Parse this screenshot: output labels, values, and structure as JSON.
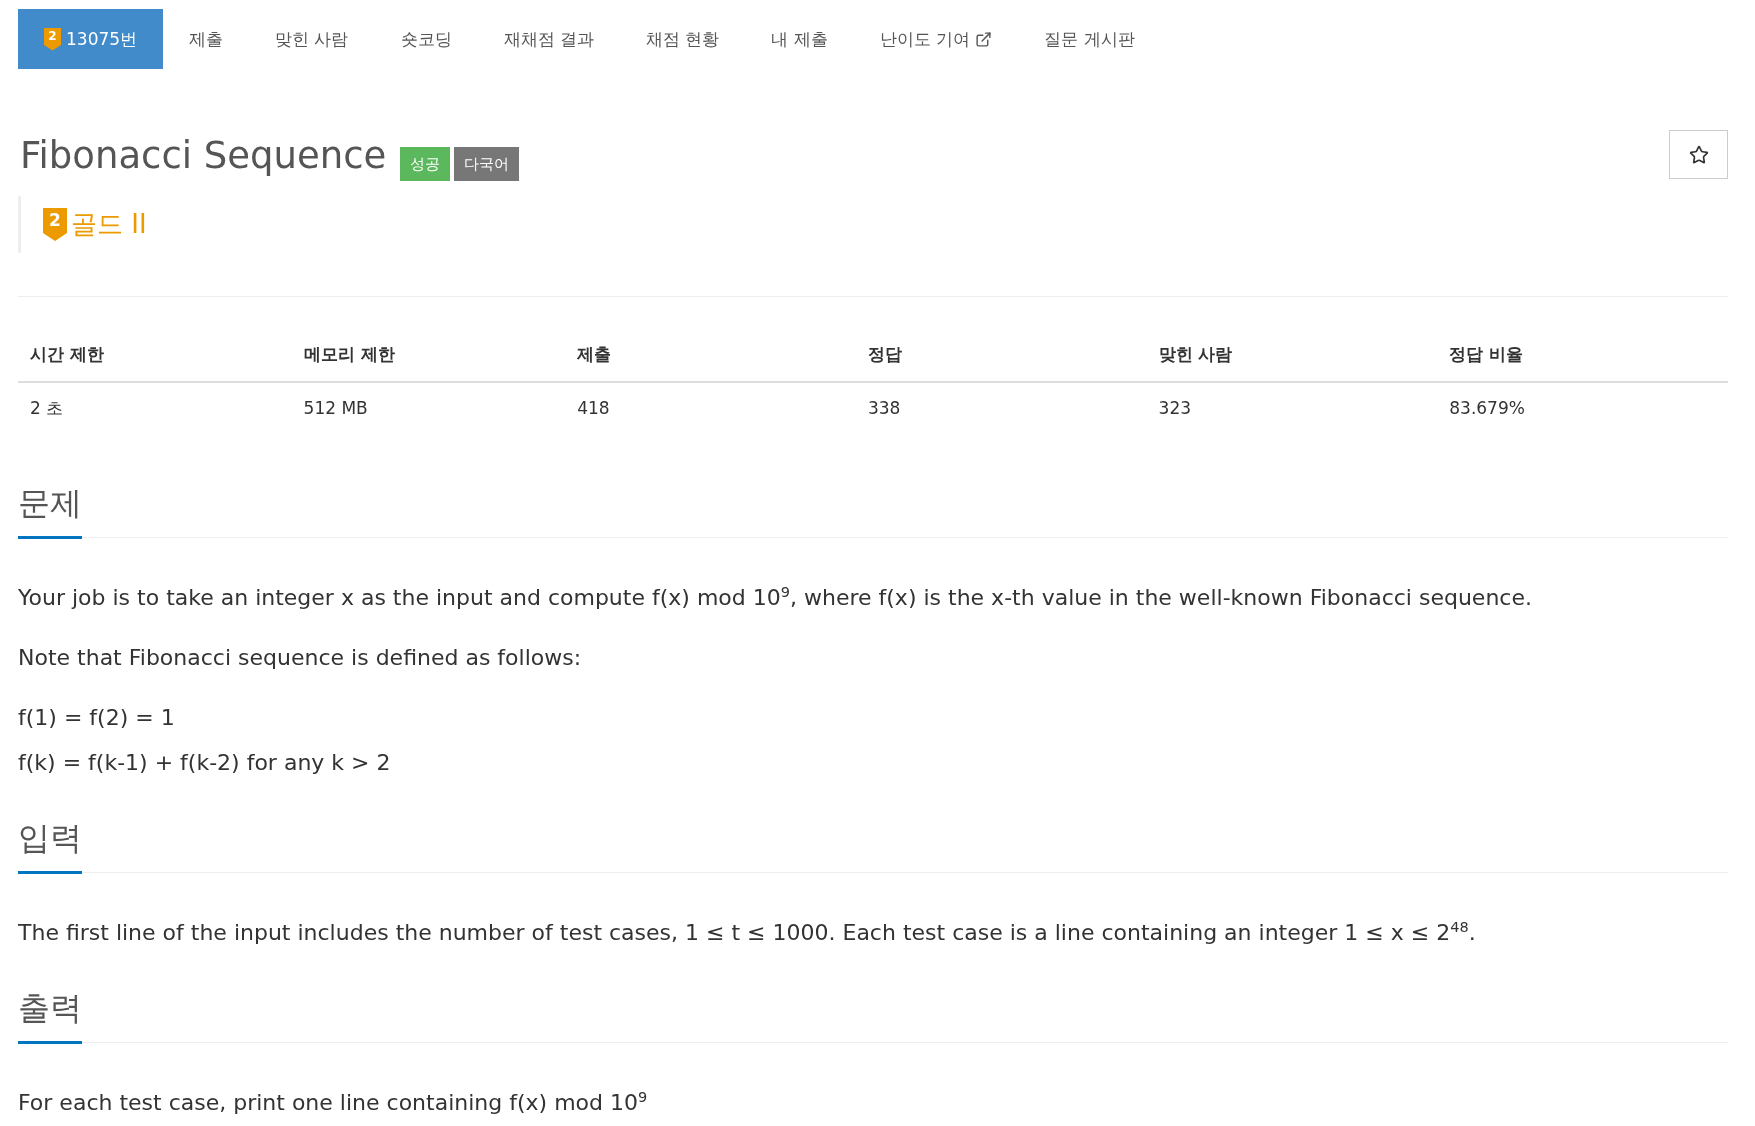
{
  "nav": {
    "tabs": [
      {
        "label": "13075번",
        "badge": "2",
        "selected": true,
        "external": false
      },
      {
        "label": "제출",
        "selected": false,
        "external": false
      },
      {
        "label": "맞힌 사람",
        "selected": false,
        "external": false
      },
      {
        "label": "숏코딩",
        "selected": false,
        "external": false
      },
      {
        "label": "재채점 결과",
        "selected": false,
        "external": false
      },
      {
        "label": "채점 현황",
        "selected": false,
        "external": false
      },
      {
        "label": "내 제출",
        "selected": false,
        "external": false
      },
      {
        "label": "난이도 기여",
        "selected": false,
        "external": true
      },
      {
        "label": "질문 게시판",
        "selected": false,
        "external": false
      }
    ]
  },
  "problem": {
    "title": "Fibonacci Sequence",
    "labels": [
      {
        "kind": "success",
        "text": "성공"
      },
      {
        "kind": "language",
        "text": "다국어"
      }
    ],
    "star_button": {
      "starred": false
    },
    "tier": {
      "badge": "2",
      "name": "골드 II"
    }
  },
  "stats": {
    "columns": [
      "시간 제한",
      "메모리 제한",
      "제출",
      "정답",
      "맞힌 사람",
      "정답 비율"
    ],
    "rows": [
      [
        "2 초",
        "512 MB",
        "418",
        "338",
        "323",
        "83.679%"
      ]
    ]
  },
  "sections": [
    {
      "heading": "문제",
      "paragraphs": [
        {
          "lines": [
            "Your job is to take an integer x as the input and compute f(x) mod 10$^{9}$, where f(x) is the x-th value in the well-known Fibonacci sequence."
          ]
        },
        {
          "lines": [
            "Note that Fibonacci sequence is defined as follows:"
          ]
        },
        {
          "lines": [
            "f(1) = f(2) = 1",
            "f(k) = f(k-1) + f(k-2) for any k > 2"
          ]
        }
      ]
    },
    {
      "heading": "입력",
      "paragraphs": [
        {
          "lines": [
            "The first line of the input includes the number of test cases, 1 ≤ t ≤ 1000. Each test case is a line containing an integer 1 ≤ x ≤ 2$^{48}$."
          ]
        }
      ]
    },
    {
      "heading": "출력",
      "paragraphs": [
        {
          "lines": [
            "For each test case, print one line containing f(x) mod 10$^{9}$"
          ]
        }
      ]
    }
  ]
}
